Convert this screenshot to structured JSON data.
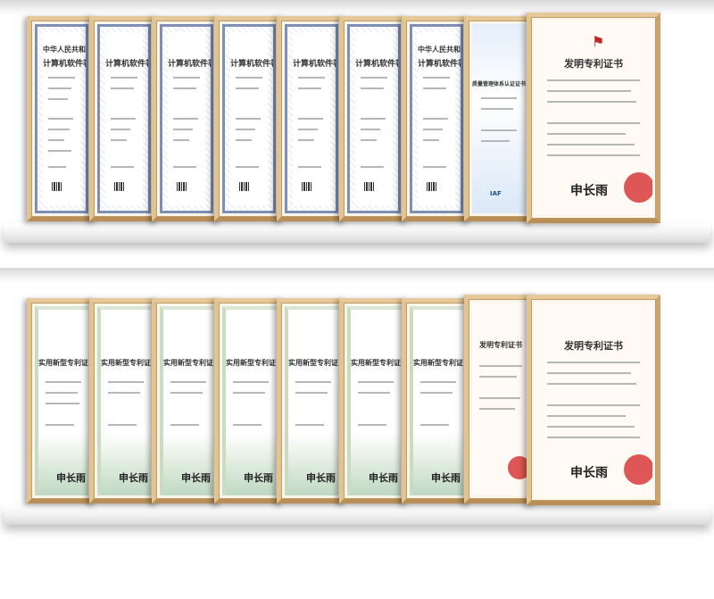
{
  "software_cert": {
    "title_line1": "中华人民共和国国家版权局",
    "title_line2": "计算机软件著作权登记证书"
  },
  "quality_cert": {
    "title": "质量管理体系认证证书",
    "badge": "IAF"
  },
  "invention_patent": {
    "title": "发明专利证书",
    "signature": "申长雨"
  },
  "utility_patent": {
    "title": "实用新型专利证书",
    "signature": "申长雨"
  },
  "top_shelf": [
    "software",
    "software",
    "software",
    "software",
    "software",
    "software",
    "software",
    "quality",
    "patent"
  ],
  "bottom_shelf": [
    "utility",
    "utility",
    "utility",
    "utility",
    "utility",
    "utility",
    "utility",
    "patent",
    "patent"
  ],
  "colors": {
    "frame": "#d9b98a",
    "seal": "#d83a3a",
    "soft_border": "#7d8fb5",
    "utility_wave": "#bfd8c2"
  }
}
